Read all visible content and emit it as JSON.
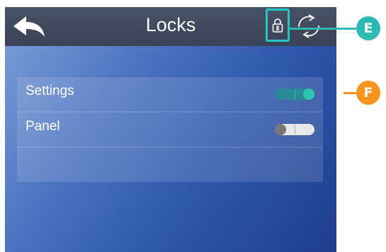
{
  "header": {
    "title": "Locks",
    "back_icon": "back-arrow-icon",
    "lock_icon": "padlock-icon",
    "refresh_icon": "refresh-icon"
  },
  "panel": {
    "rows": [
      {
        "label": "Settings",
        "toggle_on": true
      },
      {
        "label": "Panel",
        "toggle_on": false
      },
      {
        "label": ""
      }
    ]
  },
  "callouts": [
    {
      "letter": "E",
      "color": "#2db9b2"
    },
    {
      "letter": "F",
      "color": "#f7941d"
    }
  ],
  "colors": {
    "header_bg": "#3f4759",
    "accent_teal": "#27c4c6",
    "toggle_on": "#2a8a96",
    "toggle_off": "#e8e8e8",
    "callout_orange": "#f7941d"
  }
}
